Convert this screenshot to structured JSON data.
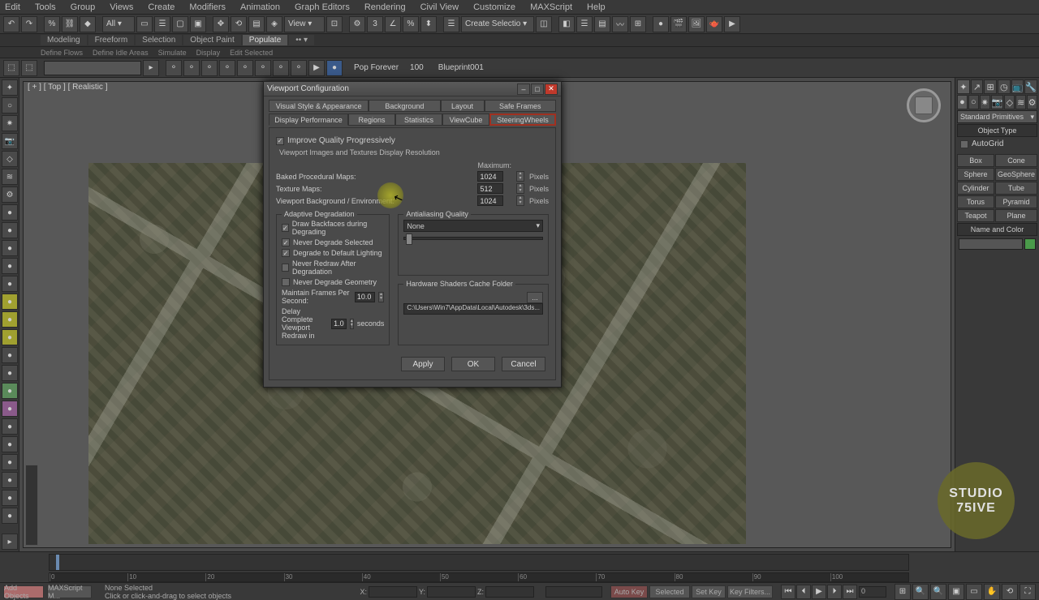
{
  "menubar": [
    "Edit",
    "Tools",
    "Group",
    "Views",
    "Create",
    "Modifiers",
    "Animation",
    "Graph Editors",
    "Rendering",
    "Civil View",
    "Customize",
    "MAXScript",
    "Help"
  ],
  "ribbon": {
    "tabs": [
      "Modeling",
      "Freeform",
      "Selection",
      "Object Paint",
      "Populate"
    ],
    "active": 4,
    "sub": [
      "Define Flows",
      "Define Idle Areas",
      "Simulate",
      "Display",
      "Edit Selected"
    ]
  },
  "second_toolbar": {
    "pop_forever": "Pop Forever",
    "range": "100",
    "label2": "Blueprint001"
  },
  "viewport": {
    "label": "[ + ] [ Top ] [ Realistic ]"
  },
  "right_panel": {
    "dropdown": "Standard Primitives",
    "object_type_hdr": "Object Type",
    "autogrid": "AutoGrid",
    "grid": [
      [
        "Box",
        "Cone"
      ],
      [
        "Sphere",
        "GeoSphere"
      ],
      [
        "Cylinder",
        "Tube"
      ],
      [
        "Torus",
        "Pyramid"
      ],
      [
        "Teapot",
        "Plane"
      ]
    ],
    "name_color_hdr": "Name and Color"
  },
  "dialog": {
    "title": "Viewport Configuration",
    "tabs_row1": [
      "Visual Style & Appearance",
      "Background",
      "Layout",
      "Safe Frames"
    ],
    "tabs_row2": [
      "Display Performance",
      "Regions",
      "Statistics",
      "ViewCube",
      "SteeringWheels"
    ],
    "active_tab": "Display Performance",
    "sel_tab": "SteeringWheels",
    "improve_quality": "Improve Quality Progressively",
    "tex_section": "Viewport Images and Textures Display Resolution",
    "tex_maximum": "Maximum:",
    "tex_rows": [
      {
        "label": "Baked Procedural Maps:",
        "val": "1024",
        "unit": "Pixels"
      },
      {
        "label": "Texture Maps:",
        "val": "512",
        "unit": "Pixels"
      },
      {
        "label": "Viewport Background / Environment:",
        "val": "1024",
        "unit": "Pixels"
      }
    ],
    "adaptive": {
      "title": "Adaptive Degradation",
      "opts": [
        {
          "label": "Draw Backfaces during Degrading",
          "checked": true
        },
        {
          "label": "Never Degrade Selected",
          "checked": true
        },
        {
          "label": "Degrade to Default Lighting",
          "checked": true
        },
        {
          "label": "Never Redraw After Degradation",
          "checked": false
        },
        {
          "label": "Never Degrade Geometry",
          "checked": false
        }
      ],
      "fps_label": "Maintain Frames Per Second:",
      "fps": "10.0",
      "redraw_label": "Delay Complete Viewport Redraw in",
      "redraw": "1.0",
      "redraw_unit": "seconds"
    },
    "antialias": {
      "title": "Antialiasing Quality",
      "value": "None"
    },
    "cache": {
      "title": "Hardware Shaders Cache Folder",
      "path": "C:\\Users\\Win7\\AppData\\Local\\Autodesk\\3ds...",
      "browse": "..."
    },
    "buttons": {
      "apply": "Apply",
      "ok": "OK",
      "cancel": "Cancel"
    }
  },
  "status": {
    "btn1": "Add Objects",
    "btn2": "MAXScript M...",
    "selection": "None Selected",
    "hint": "Click or click-and-drag to select objects",
    "autokey": "Auto Key",
    "setkey": "Set Key",
    "keyfilters": "Key Filters...",
    "selected": "Selected"
  },
  "watermark": {
    "l1": "STUDIO",
    "l2": "75IVE"
  }
}
